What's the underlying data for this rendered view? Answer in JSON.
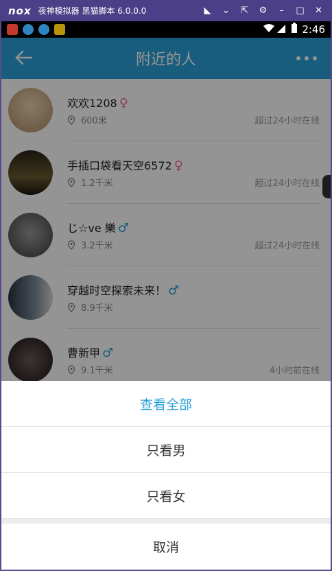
{
  "emulator": {
    "logo": "nox",
    "title": "夜神模拟器 黑猫脚本 6.0.0.0",
    "controls": [
      "◣",
      "⌄",
      "⇱",
      "⚙",
      "–",
      "□",
      "✕"
    ]
  },
  "statusbar": {
    "time": "2:46"
  },
  "appbar": {
    "title": "附近的人"
  },
  "people": [
    {
      "name": "欢欢1208",
      "gender": "♀",
      "gender_type": "f",
      "distance": "600米",
      "status": "超过24小时在线",
      "avatar_color": "#c9a98a"
    },
    {
      "name": "手插口袋看天空6572",
      "gender": "♀",
      "gender_type": "f",
      "distance": "1.2千米",
      "status": "超过24小时在线",
      "avatar_color": "#3a3020"
    },
    {
      "name": "じ☆ve 樂",
      "gender": "♂",
      "gender_type": "m",
      "distance": "3.2千米",
      "status": "超过24小时在线",
      "avatar_color": "#6d6d6d"
    },
    {
      "name": "穿越时空探索未来！",
      "gender": "♂",
      "gender_type": "m",
      "distance": "8.9千米",
      "status": "",
      "avatar_color": "#4a5a6a"
    },
    {
      "name": "曹新甲",
      "gender": "♂",
      "gender_type": "m",
      "distance": "9.1千米",
      "status": "4小时前在线",
      "avatar_color": "#3a2a2a"
    }
  ],
  "sheet": {
    "options": [
      "查看全部",
      "只看男",
      "只看女"
    ],
    "cancel": "取消"
  },
  "colors": {
    "accent": "#2aa0d8",
    "female": "#f06a9a",
    "male": "#2aa0d8"
  }
}
